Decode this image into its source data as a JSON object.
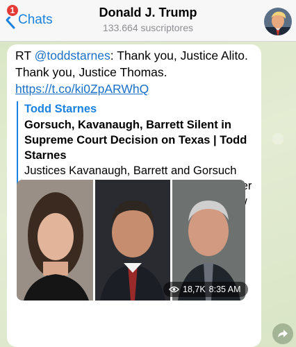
{
  "header": {
    "back_label": "Chats",
    "unread_badge": "1",
    "title": "Donald J. Trump",
    "subtitle": "133.664 suscriptores"
  },
  "message": {
    "prefix": "RT ",
    "mention": "@toddstarnes",
    "text": ": Thank you, Justice Alito. Thank you, Justice Thomas.",
    "link": "https://t.co/ki0ZpARWhQ",
    "views": "18,7K",
    "time": "8:35 AM"
  },
  "preview": {
    "site_name": "Todd Starnes",
    "title": "Gorsuch, Kavanaugh, Barrett Silent in Supreme Court Decision on Texas | Todd Starnes",
    "description": "Justices Kavanaugh, Barrett and Gorsuch were missing in action in a Friday night order from the Supreme Court denying the... View Article"
  },
  "colors": {
    "accent": "#1a82e2",
    "badge": "#e53935",
    "background": "#dfe9d2"
  },
  "icons": [
    "chevron-left-icon",
    "eye-icon",
    "share-arrow-icon"
  ]
}
